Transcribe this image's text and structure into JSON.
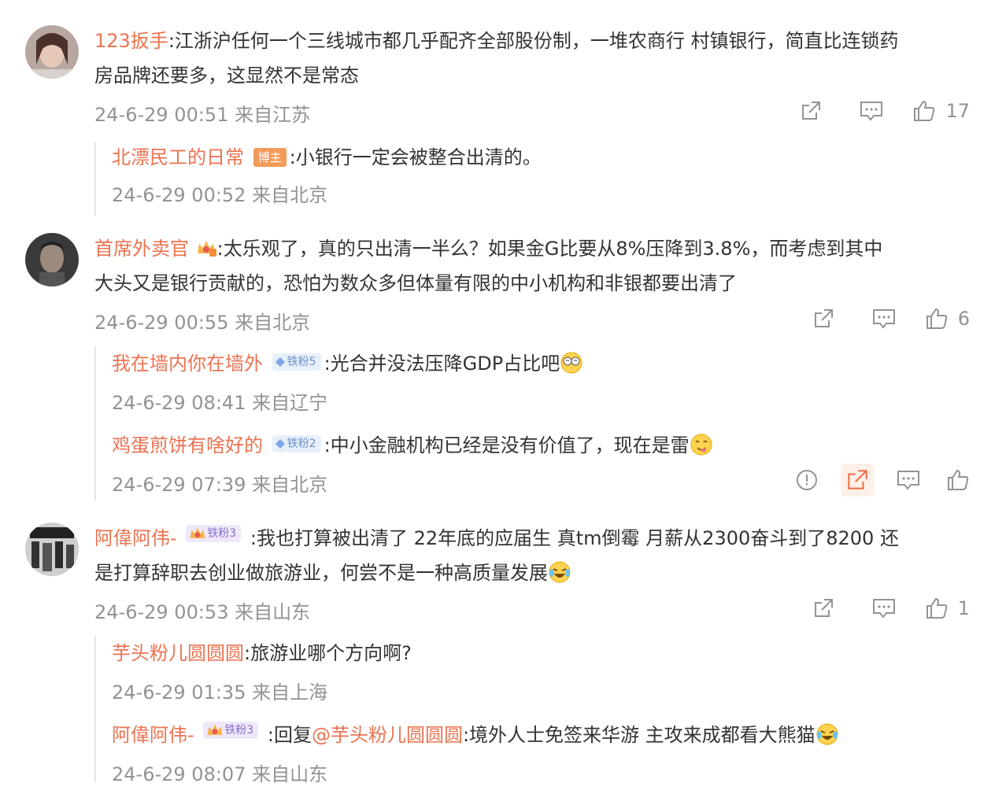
{
  "comments": [
    {
      "username": "123扳手",
      "text_line1": ":江浙沪任何一个三线城市都几乎配齐全部股份制，一堆农商行 村镇银行，简直比连锁药",
      "text_line2": "房品牌还要多，这显然不是常态",
      "meta": "24-6-29 00:51 来自江苏",
      "likes": "17",
      "replies": [
        {
          "username": "北漂民工的日常",
          "badge": "博主",
          "text": ":小银行一定会被整合出清的。",
          "meta": "24-6-29 00:52 来自北京"
        }
      ]
    },
    {
      "username": "首席外卖官",
      "text_line1": ":太乐观了，真的只出清一半么？如果金G比要从8%压降到3.8%，而考虑到其中",
      "text_line2": "大头又是银行贡献的，恐怕为数众多但体量有限的中小机构和非银都要出清了",
      "meta": "24-6-29 00:55 来自北京",
      "likes": "6",
      "replies": [
        {
          "username": "我在墙内你在墙外",
          "badge": "铁粉5",
          "text": ":光合并没法压降GDP占比吧",
          "meta": "24-6-29 08:41 来自辽宁"
        },
        {
          "username": "鸡蛋煎饼有啥好的",
          "badge": "铁粉2",
          "text": ":中小金融机构已经是没有价值了，现在是雷",
          "meta": "24-6-29 07:39 来自北京"
        }
      ]
    },
    {
      "username": "阿偉阿伟-",
      "badge": "铁粉3",
      "text_line1": ":我也打算被出清了 22年底的应届生 真tm倒霉 月薪从2300奋斗到了8200 还",
      "text_line2": "是打算辞职去创业做旅游业，何尝不是一种高质量发展",
      "meta": "24-6-29 00:53 来自山东",
      "likes": "1",
      "replies": [
        {
          "username": "芋头粉儿圆圆圆",
          "text": ":旅游业哪个方向啊?",
          "meta": "24-6-29 01:35 来自上海"
        },
        {
          "username": "阿偉阿伟-",
          "badge": "铁粉3",
          "text_prefix": ":回复",
          "mention": "@芋头粉儿圆圆圆",
          "text": ":境外人士免签来华游 主攻来成都看大熊猫",
          "meta": "24-6-29 08:07 来自山东"
        }
      ]
    }
  ],
  "colors": {
    "username": "#eb7350",
    "meta": "#939393",
    "text": "#333333",
    "divider": "#e6e6e6"
  },
  "icons": [
    "share-icon",
    "comment-icon",
    "like-icon",
    "report-icon"
  ]
}
